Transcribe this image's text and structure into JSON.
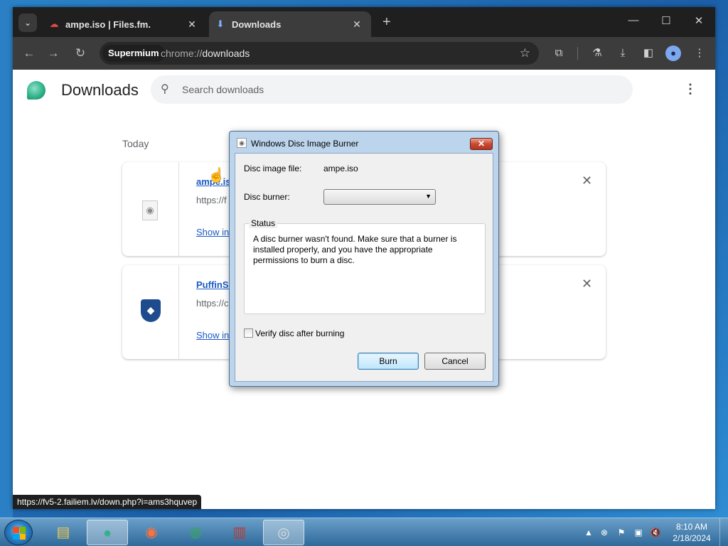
{
  "browser": {
    "tabs": [
      {
        "title": "ampe.iso | Files.fm.",
        "icon": "filesfm-icon",
        "active": false
      },
      {
        "title": "Downloads",
        "icon": "download-icon",
        "active": true
      }
    ],
    "omnibox": {
      "chip": "Supermium",
      "url_scheme": "chrome://",
      "url_path": "downloads"
    },
    "accent": "#1a59c4"
  },
  "page": {
    "title": "Downloads",
    "search_placeholder": "Search downloads",
    "date_header": "Today",
    "downloads": [
      {
        "name": "ampe.iso",
        "url": "https://f",
        "action": "Show in"
      },
      {
        "name": "PuffinSe",
        "url": "https://c",
        "action": "Show in"
      }
    ],
    "status_url": "https://fv5-2.failiem.lv/down.php?i=ams3hquvep"
  },
  "dialog": {
    "title": "Windows Disc Image Burner",
    "file_label": "Disc image file:",
    "file_value": "ampe.iso",
    "burner_label": "Disc burner:",
    "burner_value": "",
    "status_title": "Status",
    "status_text": "A disc burner wasn't found. Make sure that a burner is installed properly, and you have the appropriate permissions to burn a disc.",
    "verify_label": "Verify disc after burning",
    "verify_checked": false,
    "burn_label": "Burn",
    "cancel_label": "Cancel",
    "close_glyph": "✕"
  },
  "taskbar": {
    "apps": [
      "file-explorer-icon",
      "supermium-icon",
      "firefox-icon",
      "chrome-icon",
      "winrar-icon",
      "disc-image-icon"
    ],
    "clock_time": "8:10 AM",
    "clock_date": "2/18/2024"
  }
}
